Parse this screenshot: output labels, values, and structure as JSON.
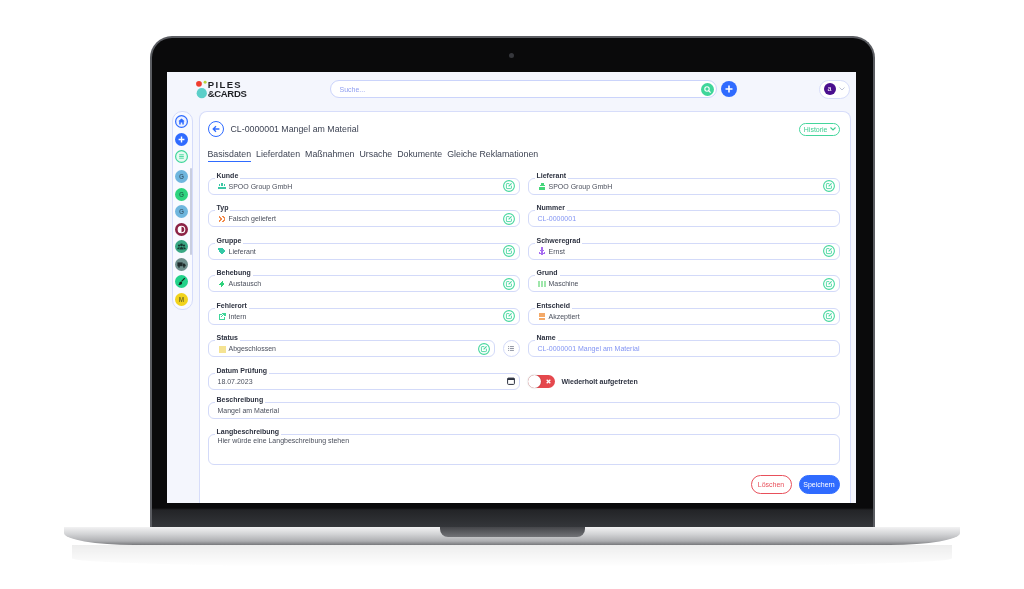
{
  "header": {
    "logo": [
      "PILES",
      "&CARDS"
    ],
    "search": {
      "placeholder": "Suche..."
    },
    "avatar": "a"
  },
  "sidebar": {
    "items": [
      {
        "kind": "home"
      },
      {
        "kind": "add"
      },
      {
        "kind": "list"
      },
      {
        "kind": "letter",
        "letter": "G",
        "color": "#6fb6de"
      },
      {
        "kind": "letter",
        "letter": "G",
        "color": "#2ed47f"
      },
      {
        "kind": "letter",
        "letter": "G",
        "color": "#6fb6de"
      },
      {
        "kind": "contrast",
        "color": "#8c2345"
      },
      {
        "kind": "people",
        "color": "#3aa884"
      },
      {
        "kind": "truck",
        "color": "#6f8f8d"
      },
      {
        "kind": "brush",
        "color": "#22d28a"
      },
      {
        "kind": "letter",
        "letter": "M",
        "color": "#f1d31c"
      }
    ]
  },
  "record": {
    "title": "CL-0000001 Mangel am Material",
    "history_button": "Historie",
    "tabs": [
      {
        "label": "Basisdaten",
        "selected": true
      },
      {
        "label": "Lieferdaten",
        "selected": false
      },
      {
        "label": "Maßnahmen",
        "selected": false
      },
      {
        "label": "Ursache",
        "selected": false
      },
      {
        "label": "Dokumente",
        "selected": false
      },
      {
        "label": "Gleiche Reklamationen",
        "selected": false
      }
    ],
    "fields": [
      {
        "kind": "select",
        "label": "Kunde",
        "value": "SPOO Group GmbH",
        "color": "#3cc7a5"
      },
      {
        "kind": "select",
        "label": "Lieferant",
        "value": "SPOO Group GmbH",
        "color": "#44d67a"
      },
      {
        "kind": "select",
        "label": "Typ",
        "value": "Falsch geliefert",
        "color": "#f28a4a"
      },
      {
        "kind": "readonly",
        "label": "Nummer",
        "value": "CL-0000001"
      },
      {
        "kind": "select",
        "label": "Gruppe",
        "value": "Lieferant",
        "color": "#35c9a6"
      },
      {
        "kind": "select",
        "label": "Schweregrad",
        "value": "Ernst",
        "color": "#a66cf0"
      },
      {
        "kind": "select",
        "label": "Behebung",
        "value": "Austausch",
        "color": "#2fd27c"
      },
      {
        "kind": "select",
        "label": "Grund",
        "value": "Maschine",
        "color": "#9fe6ab"
      },
      {
        "kind": "select",
        "label": "Fehlerort",
        "value": "Intern",
        "color": "#3fd69a"
      },
      {
        "kind": "select",
        "label": "Entscheid",
        "value": "Akzeptiert",
        "color": "#f4a968"
      },
      {
        "kind": "picker",
        "label": "Status",
        "value": "Abgeschlossen",
        "color": "#f5e392"
      },
      {
        "kind": "readonly",
        "label": "Name",
        "value": "CL-0000001 Mangel am Material"
      },
      {
        "kind": "date",
        "label": "Datum Prüfung",
        "value": "18.07.2023"
      },
      {
        "kind": "toggle",
        "label": "Wiederholt aufgetreten",
        "on": false
      },
      {
        "kind": "text",
        "label": "Beschreibung",
        "value": "Mangel am Material"
      },
      {
        "kind": "textarea",
        "label": "Langbeschreibung",
        "value": "Hier würde eine Langbeschreibung stehen"
      }
    ],
    "actions": [
      {
        "kind": "danger",
        "label": "Löschen"
      },
      {
        "kind": "primary",
        "label": "Speichern"
      }
    ]
  }
}
